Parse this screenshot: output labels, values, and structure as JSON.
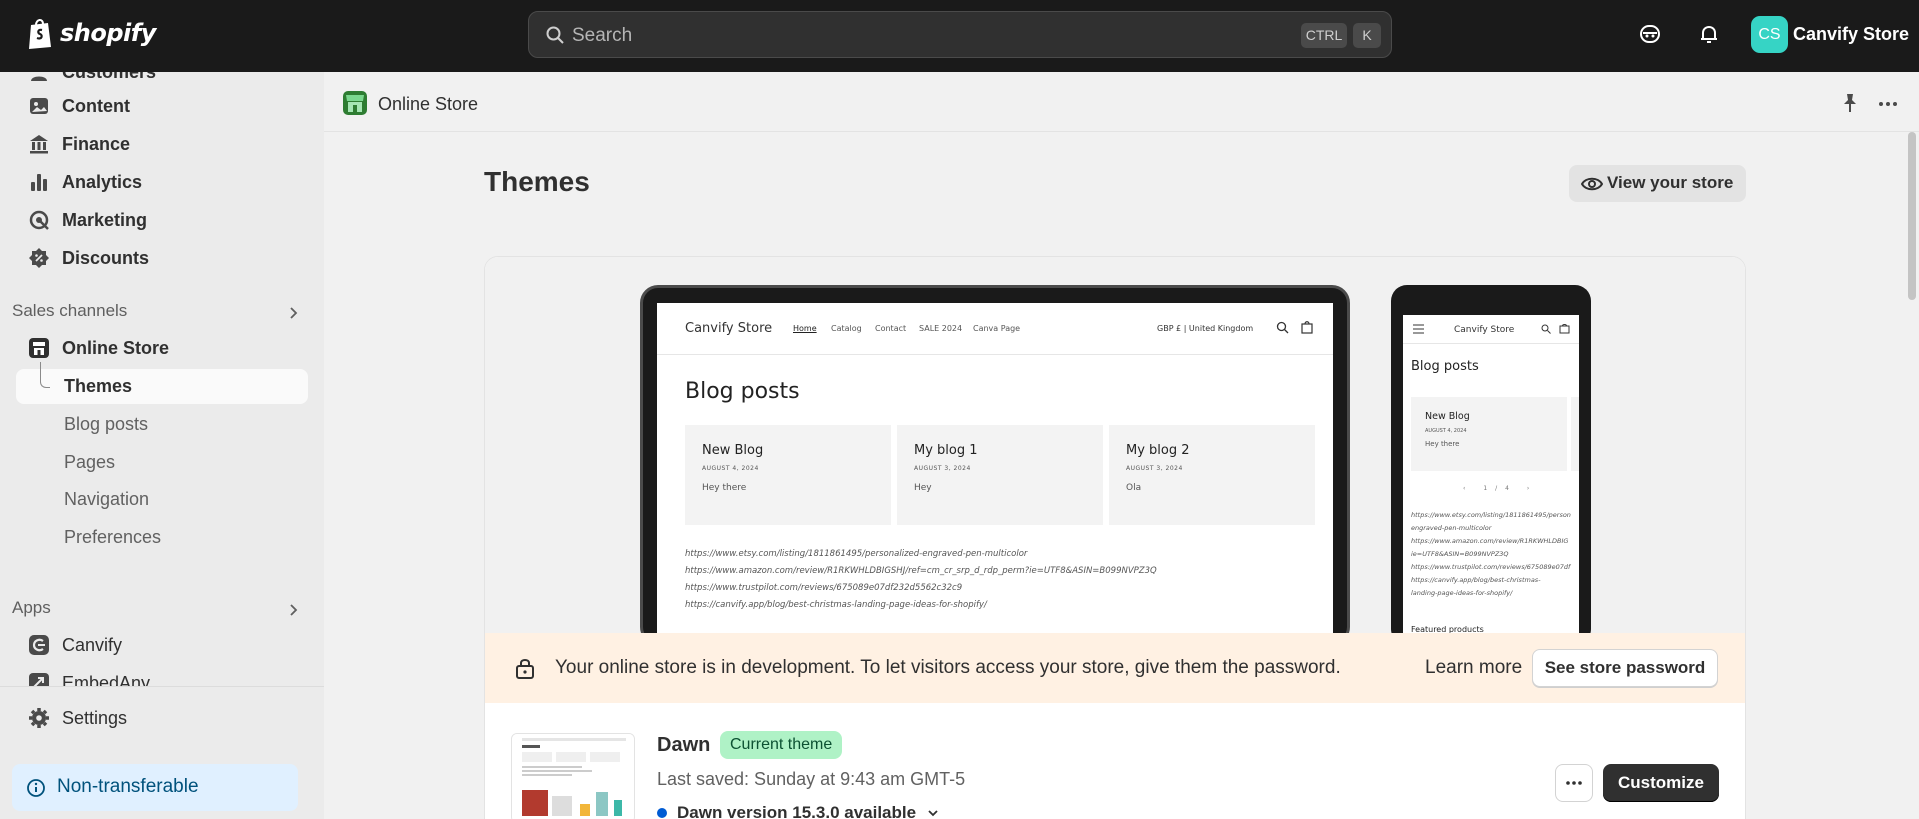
{
  "topbar": {
    "brand": "shopify",
    "search_placeholder": "Search",
    "shortcut_ctrl": "CTRL",
    "shortcut_key": "K",
    "avatar_initials": "CS",
    "store_name": "Canvify Store"
  },
  "sidebar": {
    "items": [
      {
        "label": "Customers"
      },
      {
        "label": "Content"
      },
      {
        "label": "Finance"
      },
      {
        "label": "Analytics"
      },
      {
        "label": "Marketing"
      },
      {
        "label": "Discounts"
      }
    ],
    "sales_channels_heading": "Sales channels",
    "online_store": "Online Store",
    "subitems": [
      "Themes",
      "Blog posts",
      "Pages",
      "Navigation",
      "Preferences"
    ],
    "apps_heading": "Apps",
    "apps": [
      "Canvify",
      "EmbedAny"
    ],
    "settings": "Settings",
    "non_transferable": "Non-transferable"
  },
  "header": {
    "title": "Online Store"
  },
  "page": {
    "title": "Themes",
    "view_store": "View your store"
  },
  "preview": {
    "store_name": "Canvify Store",
    "nav": [
      "Home",
      "Catalog",
      "Contact",
      "SALE 2024",
      "Canva Page"
    ],
    "currency": "GBP £ | United Kingdom",
    "blog_title": "Blog posts",
    "posts": [
      {
        "title": "New Blog",
        "date": "AUGUST 4, 2024",
        "body": "Hey there"
      },
      {
        "title": "My blog 1",
        "date": "AUGUST 3, 2024",
        "body": "Hey"
      },
      {
        "title": "My blog 2",
        "date": "AUGUST 3, 2024",
        "body": "Ola"
      }
    ],
    "links": [
      "https://www.etsy.com/listing/1811861495/personalized-engraved-pen-multicolor",
      "https://www.amazon.com/review/R1RKWHLDBIGSHJ/ref=cm_cr_srp_d_rdp_perm?ie=UTF8&ASIN=B099NVPZ3Q",
      "https://www.trustpilot.com/reviews/675089e07df232d5562c32c9",
      "https://canvify.app/blog/best-christmas-landing-page-ideas-for-shopify/"
    ],
    "mobile_pager": "1/4",
    "mobile_links": [
      "https://www.etsy.com/listing/1811861495/person",
      "engraved-pen-multicolor",
      "https://www.amazon.com/review/R1RKWHLDBIG",
      "ie=UTF8&ASIN=B099NVPZ3Q",
      "https://www.trustpilot.com/reviews/675089e07df",
      "https://canvify.app/blog/best-christmas-",
      "landing-page-ideas-for-shopify/"
    ],
    "mobile_featured": "Featured products"
  },
  "banner": {
    "message": "Your online store is in development. To let visitors access your store, give them the password.",
    "learn_more": "Learn more",
    "button": "See store password"
  },
  "theme": {
    "name": "Dawn",
    "badge": "Current theme",
    "last_saved": "Last saved: Sunday at 9:43 am GMT-5",
    "version": "Dawn version 15.3.0 available",
    "customize": "Customize"
  },
  "colors": {
    "topbar": "#1a1a1a",
    "accent_teal": "#36d4c5",
    "badge_green": "#aff2c6",
    "banner_bg": "#fff1e3",
    "info_bg": "#e0f0ff"
  }
}
